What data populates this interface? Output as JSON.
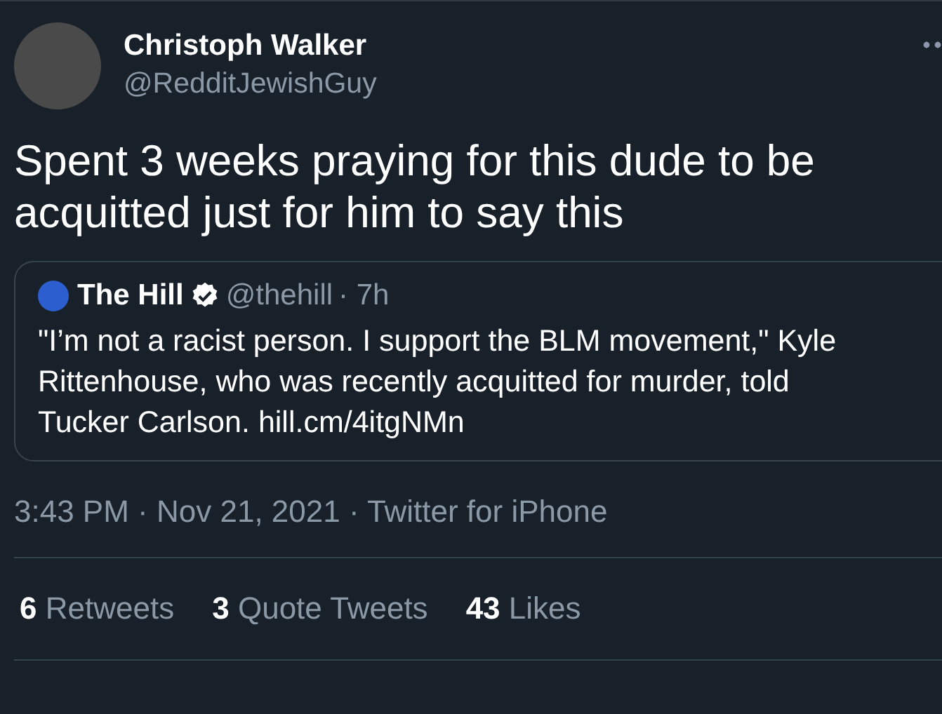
{
  "author": {
    "name": "Christoph Walker",
    "handle": "@RedditJewishGuy"
  },
  "tweet_text": "Spent 3 weeks praying for this dude to be acquitted just for him to say this",
  "quoted_tweet": {
    "name": "The Hill",
    "verified": true,
    "handle": "@thehill",
    "time": "· 7h",
    "text": "\"I’m not a racist person. I support the BLM movement,\" Kyle Rittenhouse, who was recently acquitted for murder, told Tucker Carlson.",
    "link": "hill.cm/4itgNMn"
  },
  "timestamp": "3:43 PM · Nov 21, 2021 · Twitter for iPhone",
  "stats": [
    {
      "count": "6",
      "label": "Retweets"
    },
    {
      "count": "3",
      "label": "Quote Tweets"
    },
    {
      "count": "43",
      "label": "Likes"
    }
  ]
}
